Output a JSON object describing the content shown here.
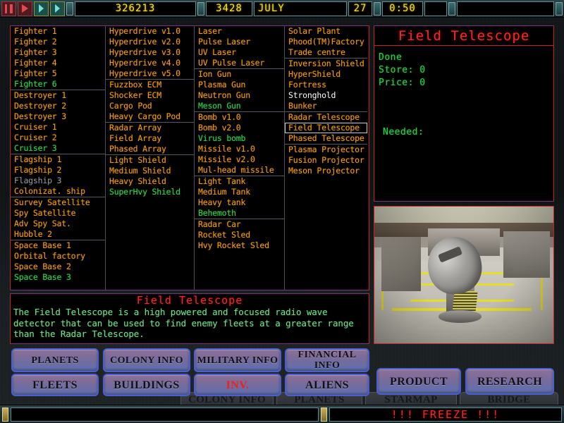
{
  "topbar": {
    "buttons": [
      {
        "name": "pause-button",
        "icon": "pause-icon"
      },
      {
        "name": "play-button",
        "icon": "play-icon"
      },
      {
        "name": "fast-forward-button",
        "icon": "fast-forward-icon"
      },
      {
        "name": "very-fast-forward-button",
        "icon": "double-fast-forward-icon"
      }
    ],
    "credits": "326213",
    "year": "3428",
    "month": "JULY",
    "day": "27",
    "clock": "0:50"
  },
  "colors": {
    "orange": "#f09a08",
    "green": "#2fd44a",
    "red": "#ef2a27",
    "gray": "#9aa0a6",
    "lcd_yellow": "#ffe514",
    "button_face": "#7a6b9a",
    "button_border": "#4a5fd0"
  },
  "inventions_list": {
    "columns": [
      {
        "id": "ships",
        "groups": [
          {
            "items": [
              {
                "label": "Fighter 1",
                "state": "available"
              },
              {
                "label": "Fighter 2",
                "state": "available"
              },
              {
                "label": "Fighter 3",
                "state": "available"
              },
              {
                "label": "Fighter 4",
                "state": "available"
              },
              {
                "label": "Fighter 5",
                "state": "available"
              },
              {
                "label": "Fighter 6",
                "state": "researching"
              }
            ]
          },
          {
            "items": [
              {
                "label": "Destroyer 1",
                "state": "available"
              },
              {
                "label": "Destroyer 2",
                "state": "available"
              },
              {
                "label": "Destroyer 3",
                "state": "available"
              },
              {
                "label": "Cruiser 1",
                "state": "available"
              },
              {
                "label": "Cruiser 2",
                "state": "available"
              },
              {
                "label": "Cruiser 3",
                "state": "researching"
              }
            ]
          },
          {
            "items": [
              {
                "label": "Flagship 1",
                "state": "available"
              },
              {
                "label": "Flagship 2",
                "state": "available"
              },
              {
                "label": "Flagship 3",
                "state": "locked"
              },
              {
                "label": "Colonizat. ship",
                "state": "available"
              }
            ]
          },
          {
            "items": [
              {
                "label": "Survey Satellite",
                "state": "available"
              },
              {
                "label": "Spy Satellite",
                "state": "available"
              },
              {
                "label": "Adv Spy Sat.",
                "state": "available"
              },
              {
                "label": "Hubble 2",
                "state": "available"
              }
            ]
          },
          {
            "items": [
              {
                "label": "Space Base 1",
                "state": "available"
              },
              {
                "label": "Orbital factory",
                "state": "available"
              },
              {
                "label": "Space Base 2",
                "state": "available"
              },
              {
                "label": "Space Base 3",
                "state": "researching"
              }
            ]
          }
        ]
      },
      {
        "id": "systems",
        "groups": [
          {
            "items": [
              {
                "label": "Hyperdrive v1.0",
                "state": "available"
              },
              {
                "label": "Hyperdrive v2.0",
                "state": "available"
              },
              {
                "label": "Hyperdrive v3.0",
                "state": "available"
              },
              {
                "label": "Hyperdrive v4.0",
                "state": "available"
              },
              {
                "label": "Hyperdrive v5.0",
                "state": "available"
              }
            ]
          },
          {
            "items": [
              {
                "label": "Fuzzbox ECM",
                "state": "available"
              },
              {
                "label": "Shocker ECM",
                "state": "available"
              },
              {
                "label": "Cargo Pod",
                "state": "available"
              },
              {
                "label": "Heavy Cargo Pod",
                "state": "available"
              }
            ]
          },
          {
            "items": [
              {
                "label": "Radar Array",
                "state": "available"
              },
              {
                "label": "Field Array",
                "state": "available"
              },
              {
                "label": "Phased Array",
                "state": "available"
              }
            ]
          },
          {
            "items": [
              {
                "label": "Light Shield",
                "state": "available"
              },
              {
                "label": "Medium Shield",
                "state": "available"
              },
              {
                "label": "Heavy Shield",
                "state": "available"
              },
              {
                "label": "SuperHvy Shield",
                "state": "researching"
              }
            ]
          }
        ]
      },
      {
        "id": "weapons",
        "groups": [
          {
            "items": [
              {
                "label": "Laser",
                "state": "available"
              },
              {
                "label": "Pulse Laser",
                "state": "available"
              },
              {
                "label": "UV Laser",
                "state": "available"
              },
              {
                "label": "UV Pulse Laser",
                "state": "available"
              }
            ]
          },
          {
            "items": [
              {
                "label": "Ion Gun",
                "state": "available"
              },
              {
                "label": "Plasma Gun",
                "state": "available"
              },
              {
                "label": "Neutron Gun",
                "state": "available"
              },
              {
                "label": "Meson Gun",
                "state": "researching"
              }
            ]
          },
          {
            "items": [
              {
                "label": "Bomb v1.0",
                "state": "available"
              },
              {
                "label": "Bomb v2.0",
                "state": "available"
              },
              {
                "label": "Virus bomb",
                "state": "researching"
              },
              {
                "label": "Missile v1.0",
                "state": "available"
              },
              {
                "label": "Missile v2.0",
                "state": "available"
              },
              {
                "label": "Mul-head missile",
                "state": "available"
              }
            ]
          },
          {
            "items": [
              {
                "label": "Light Tank",
                "state": "available"
              },
              {
                "label": "Medium Tank",
                "state": "available"
              },
              {
                "label": "Heavy tank",
                "state": "available"
              },
              {
                "label": "Behemoth",
                "state": "researching"
              }
            ]
          },
          {
            "items": [
              {
                "label": "Radar Car",
                "state": "available"
              },
              {
                "label": "Rocket Sled",
                "state": "available"
              },
              {
                "label": "Hvy Rocket Sled",
                "state": "available"
              }
            ]
          }
        ]
      },
      {
        "id": "buildings",
        "groups": [
          {
            "items": [
              {
                "label": "Solar Plant",
                "state": "available"
              },
              {
                "label": "Phood(TM)Factory",
                "state": "available"
              },
              {
                "label": "Trade centre",
                "state": "available"
              }
            ]
          },
          {
            "items": [
              {
                "label": "Inversion Shield",
                "state": "available"
              },
              {
                "label": "HyperShield",
                "state": "available"
              },
              {
                "label": "Fortress",
                "state": "available"
              },
              {
                "label": "Stronghold",
                "state": "highlighted"
              },
              {
                "label": "Bunker",
                "state": "available"
              }
            ]
          },
          {
            "items": [
              {
                "label": "Radar Telescope",
                "state": "available"
              },
              {
                "label": "Field Telescope",
                "state": "selected"
              },
              {
                "label": "Phased Telescope",
                "state": "available"
              }
            ]
          },
          {
            "items": [
              {
                "label": "Plasma Projector",
                "state": "available"
              },
              {
                "label": "Fusion Projector",
                "state": "available"
              },
              {
                "label": "Meson Projector",
                "state": "available"
              }
            ]
          }
        ]
      }
    ]
  },
  "info_panel": {
    "title": "Field Telescope",
    "status": "Done",
    "store_label": "Store: 0",
    "price_label": "Price: 0",
    "needed_label": "Needed:"
  },
  "description_panel": {
    "title": "Field Telescope",
    "text": "The Field Telescope is a high powered and focused radio wave detector that can be used to find enemy fleets at a greater range than the Radar Telescope."
  },
  "nav_buttons": {
    "row1": [
      {
        "label": "PLANETS",
        "active": false
      },
      {
        "label": "COLONY INFO",
        "active": false
      },
      {
        "label": "MILITARY INFO",
        "active": false
      },
      {
        "label": "FINANCIAL INFO",
        "active": false
      }
    ],
    "row2": [
      {
        "label": "FLEETS",
        "active": false
      },
      {
        "label": "BUILDINGS",
        "active": false
      },
      {
        "label": "INV.",
        "active": true
      },
      {
        "label": "ALIENS",
        "active": false
      }
    ],
    "side": [
      {
        "label": "PRODUCT",
        "active": false
      },
      {
        "label": "RESEARCH",
        "active": false
      }
    ]
  },
  "background_buttons": [
    "COLONY INFO",
    "PLANETS",
    "STARMAP",
    "BRIDGE"
  ],
  "statusbar": {
    "message": "",
    "freeze": "!!! FREEZE !!!"
  }
}
